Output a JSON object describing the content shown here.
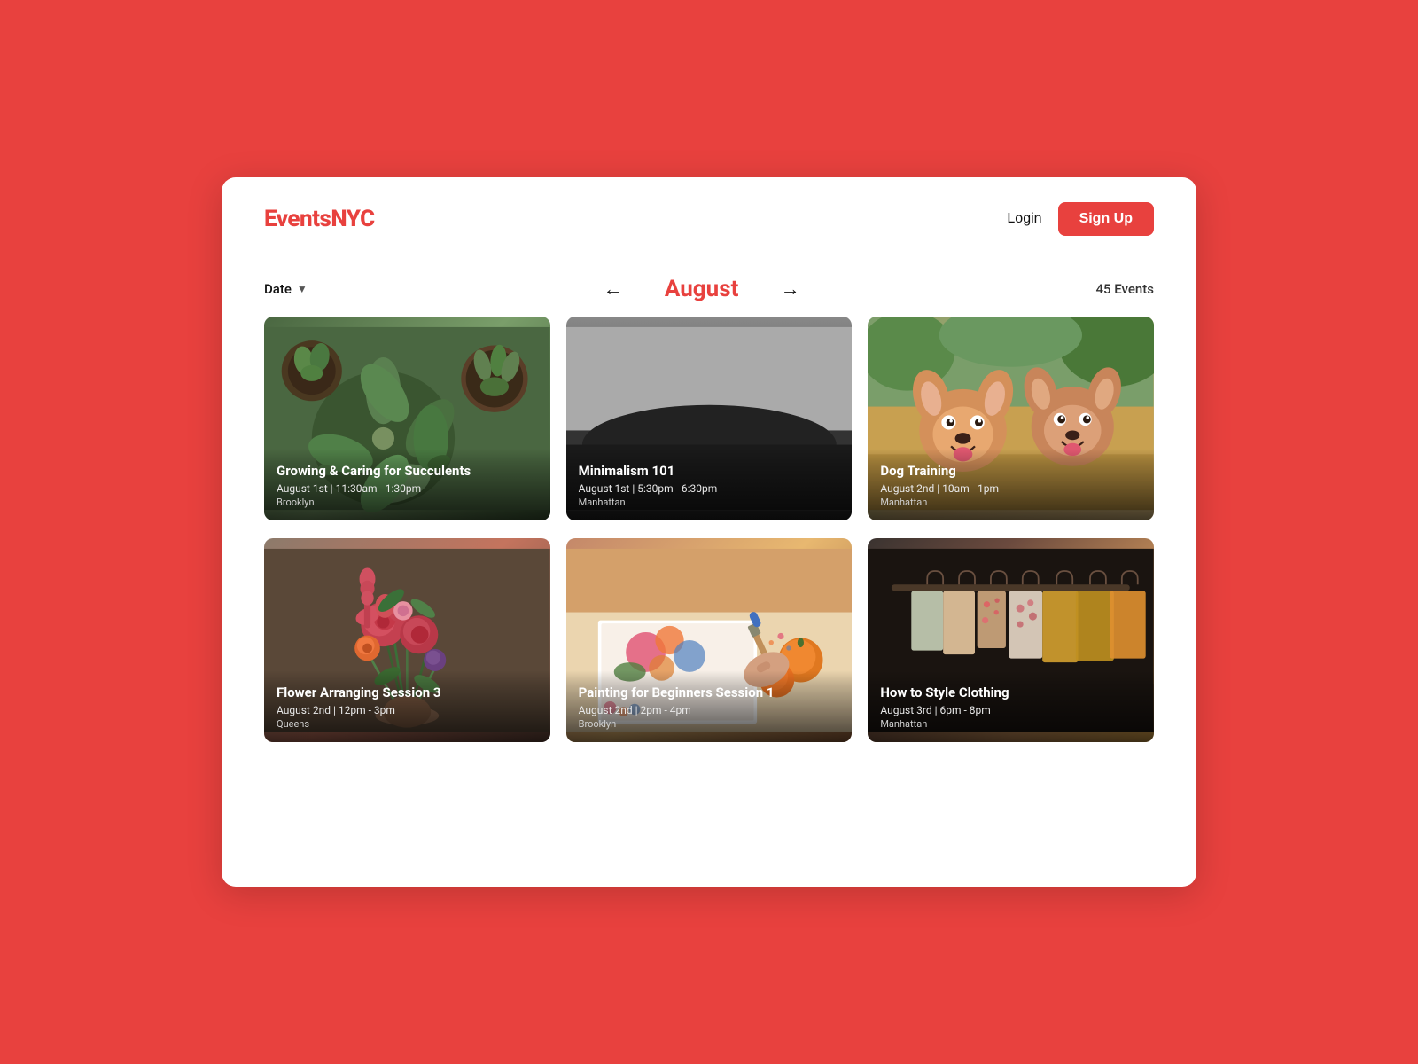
{
  "header": {
    "logo_text": "Events",
    "logo_accent": "NYC",
    "login_label": "Login",
    "signup_label": "Sign Up"
  },
  "controls": {
    "date_filter_label": "Date",
    "month": "August",
    "events_count": "45 Events"
  },
  "events_row1": [
    {
      "id": "succulents",
      "title": "Growing & Caring for Succulents",
      "date": "August 1st | 11:30am - 1:30pm",
      "location": "Brooklyn",
      "bg_class": "card-succulents"
    },
    {
      "id": "minimalism",
      "title": "Minimalism 101",
      "date": "August 1st | 5:30pm - 6:30pm",
      "location": "Manhattan",
      "bg_class": "card-minimalism"
    },
    {
      "id": "dog",
      "title": "Dog Training",
      "date": "August 2nd | 10am - 1pm",
      "location": "Manhattan",
      "bg_class": "card-dog"
    }
  ],
  "events_row2": [
    {
      "id": "flowers",
      "title": "Flower Arranging Session 3",
      "date": "August 2nd | 12pm - 3pm",
      "location": "Queens",
      "bg_class": "card-flowers"
    },
    {
      "id": "painting",
      "title": "Painting for Beginners Session 1",
      "date": "August 2nd | 2pm - 4pm",
      "location": "Brooklyn",
      "bg_class": "card-painting"
    },
    {
      "id": "clothing",
      "title": "How to Style Clothing",
      "date": "August 3rd | 6pm - 8pm",
      "location": "Manhattan",
      "bg_class": "card-clothing"
    }
  ]
}
